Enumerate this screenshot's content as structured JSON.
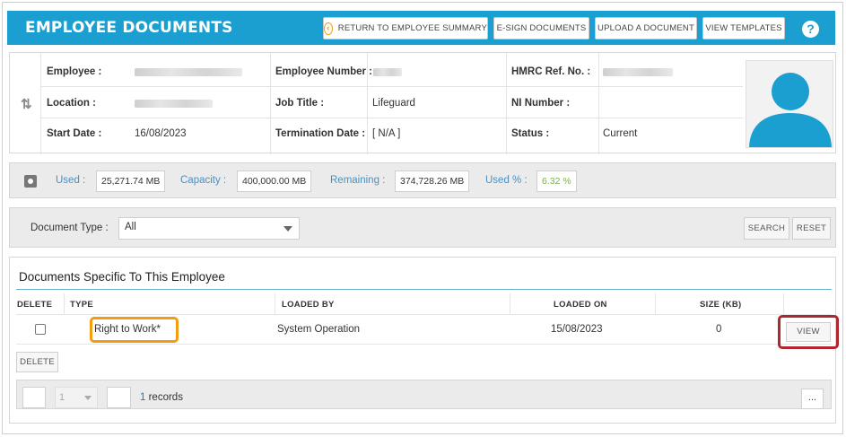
{
  "header": {
    "title": "EMPLOYEE DOCUMENTS",
    "buttons": {
      "return_summary": "RETURN TO EMPLOYEE SUMMARY",
      "esign": "E-SIGN DOCUMENTS",
      "upload": "UPLOAD A DOCUMENT",
      "templates": "VIEW TEMPLATES"
    },
    "help_glyph": "?"
  },
  "employee": {
    "labels": {
      "employee": "Employee :",
      "employee_number": "Employee Number :",
      "hmrc": "HMRC Ref. No. :",
      "location": "Location :",
      "job_title": "Job Title :",
      "ni_number": "NI Number :",
      "start_date": "Start Date :",
      "termination_date": "Termination Date :",
      "status": "Status :"
    },
    "values": {
      "job_title": "Lifeguard",
      "start_date": "16/08/2023",
      "termination_date": "[ N/A ]",
      "status": "Current"
    }
  },
  "storage": {
    "used_label": "Used :",
    "used": "25,271.74 MB",
    "capacity_label": "Capacity :",
    "capacity": "400,000.00 MB",
    "remaining_label": "Remaining :",
    "remaining": "374,728.26 MB",
    "percent_label": "Used % :",
    "percent": "6.32 %"
  },
  "filter": {
    "doc_type_label": "Document Type :",
    "doc_type_value": "All",
    "search": "SEARCH",
    "reset": "RESET"
  },
  "documents": {
    "title": "Documents Specific To This Employee",
    "columns": {
      "delete": "DELETE",
      "type": "TYPE",
      "loaded_by": "LOADED BY",
      "loaded_on": "LOADED ON",
      "size": "SIZE (KB)"
    },
    "rows": [
      {
        "type": "Right to Work*",
        "loaded_by": "System Operation",
        "loaded_on": "15/08/2023",
        "size": "0",
        "view": "VIEW"
      }
    ],
    "delete_button": "DELETE",
    "pager": {
      "page": "1",
      "count": "1",
      "records_suffix": " records",
      "more": "..."
    }
  },
  "colors": {
    "header_blue": "#1a9fd0",
    "highlight_orange": "#f39c12",
    "highlight_red": "#b0262f",
    "avatar_blue": "#1a9fd0"
  }
}
